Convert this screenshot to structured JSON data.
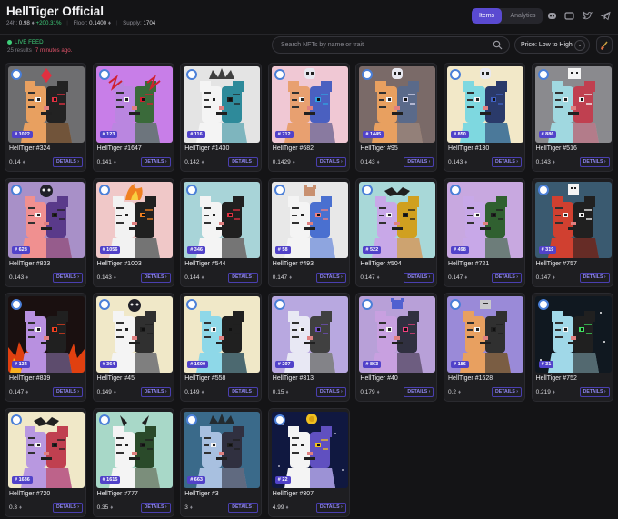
{
  "header": {
    "title": "HellTiger Official",
    "stats": {
      "vol_label": "24h:",
      "vol_value": "0.98",
      "vol_change": "+200.31%",
      "floor_label": "Floor:",
      "floor_value": "0.1400",
      "supply_label": "Supply:",
      "supply_value": "1704"
    },
    "tabs": [
      {
        "label": "Items",
        "active": true
      },
      {
        "label": "Analytics",
        "active": false
      }
    ],
    "icons": [
      "discord-icon",
      "website-icon",
      "twitter-icon",
      "telegram-icon"
    ]
  },
  "toolbar": {
    "live_label": "LIVE FEED",
    "results_text": "25 results",
    "updated_text": "7 minutes ago.",
    "search_placeholder": "Search NFTs by name or trait",
    "sort_label": "Price: Low to High"
  },
  "colors": {
    "accent": "#5a4ad1",
    "positive": "#3fcf7a",
    "negative": "#e2536a"
  },
  "items": [
    {
      "name": "HellTiger #324",
      "id": "# 1022",
      "price": "0.14",
      "details": "DETAILS ›",
      "bg": "#6e6e70",
      "fur": "#e8a060",
      "face": "#222222",
      "accent": "#e03040",
      "ornament": "diamond"
    },
    {
      "name": "HellTiger #1647",
      "id": "# 123",
      "price": "0.141",
      "details": "DETAILS ›",
      "bg": "#c87ee8",
      "fur": "#ba86e0",
      "face": "#3a6a3a",
      "accent": "#d02030",
      "ornament": "bolts"
    },
    {
      "name": "HellTiger #1430",
      "id": "# 116",
      "price": "0.142",
      "details": "DETAILS ›",
      "bg": "#e4e4e4",
      "fur": "#f4f4f4",
      "face": "#2e8a9a",
      "accent": "#222222",
      "ornament": "crown"
    },
    {
      "name": "HellTiger #682",
      "id": "# 712",
      "price": "0.1429",
      "details": "DETAILS ›",
      "bg": "#f0c8d4",
      "fur": "#e8a070",
      "face": "#4a60c0",
      "accent": "#30a0e0",
      "ornament": "skull"
    },
    {
      "name": "HellTiger #95",
      "id": "# 1445",
      "price": "0.143",
      "details": "DETAILS ›",
      "bg": "#7a6a68",
      "fur": "#e8a060",
      "face": "#5a6a8a",
      "accent": "#d8d8f0",
      "ornament": "skull"
    },
    {
      "name": "HellTiger #130",
      "id": "# 850",
      "price": "0.143",
      "details": "DETAILS ›",
      "bg": "#f2e8c8",
      "fur": "#7ed8e0",
      "face": "#2a3a6a",
      "accent": "#4060c0",
      "ornament": "skull"
    },
    {
      "name": "HellTiger #516",
      "id": "# 886",
      "price": "0.143",
      "details": "DETAILS ›",
      "bg": "#8a8a8e",
      "fur": "#a0d8e0",
      "face": "#c04050",
      "accent": "#f0f0f0",
      "ornament": "cat"
    },
    {
      "name": "HellTiger #833",
      "id": "# 628",
      "price": "0.143",
      "details": "DETAILS ›",
      "bg": "#a890c8",
      "fur": "#f09090",
      "face": "#5a3a8a",
      "accent": "#202020",
      "ornament": "blob"
    },
    {
      "name": "HellTiger #1003",
      "id": "# 1056",
      "price": "0.143",
      "details": "DETAILS ›",
      "bg": "#f0c8c8",
      "fur": "#f2f2f2",
      "face": "#202020",
      "accent": "#f08020",
      "ornament": "flame"
    },
    {
      "name": "HellTiger #544",
      "id": "# 346",
      "price": "0.144",
      "details": "DETAILS ›",
      "bg": "#a8d4d8",
      "fur": "#f4f4f4",
      "face": "#202020",
      "accent": "#e03040",
      "ornament": "none"
    },
    {
      "name": "HellTiger #493",
      "id": "# 58",
      "price": "0.147",
      "details": "DETAILS ›",
      "bg": "#e8e8e8",
      "fur": "#f4f4f4",
      "face": "#4a70d0",
      "accent": "#f08080",
      "ornament": "bear"
    },
    {
      "name": "HellTiger #504",
      "id": "# 522",
      "price": "0.147",
      "details": "DETAILS ›",
      "bg": "#a8d8d8",
      "fur": "#c8a8e8",
      "face": "#d0a020",
      "accent": "#202020",
      "ornament": "bat"
    },
    {
      "name": "HellTiger #721",
      "id": "# 498",
      "price": "0.147",
      "details": "DETAILS ›",
      "bg": "#c8a8e0",
      "fur": "#c8a8e8",
      "face": "#306030",
      "accent": "#202020",
      "ornament": "none"
    },
    {
      "name": "HellTiger #757",
      "id": "# 319",
      "price": "0.147",
      "details": "DETAILS ›",
      "bg": "#3a5a70",
      "fur": "#d04030",
      "face": "#202020",
      "accent": "#f0f0f0",
      "ornament": "ghost"
    },
    {
      "name": "HellTiger #839",
      "id": "# 134",
      "price": "0.147",
      "details": "DETAILS ›",
      "bg": "#1a1010",
      "fur": "#b890e0",
      "face": "#202020",
      "accent": "#f04020",
      "ornament": "fire"
    },
    {
      "name": "HellTiger #45",
      "id": "# 364",
      "price": "0.149",
      "details": "DETAILS ›",
      "bg": "#f0e8c8",
      "fur": "#f4f4f4",
      "face": "#303030",
      "accent": "#202020",
      "ornament": "blob"
    },
    {
      "name": "HellTiger #558",
      "id": "# 1600",
      "price": "0.149",
      "details": "DETAILS ›",
      "bg": "#f0e8c8",
      "fur": "#8ed8e8",
      "face": "#202020",
      "accent": "#202020",
      "ornament": "none"
    },
    {
      "name": "HellTiger #313",
      "id": "# 297",
      "price": "0.15",
      "details": "DETAILS ›",
      "bg": "#b8a8e0",
      "fur": "#e8e8f4",
      "face": "#404040",
      "accent": "#7050c0",
      "ornament": "none"
    },
    {
      "name": "HellTiger #40",
      "id": "# 863",
      "price": "0.179",
      "details": "DETAILS ›",
      "bg": "#b8a0d8",
      "fur": "#c8a0e0",
      "face": "#303040",
      "accent": "#f04080",
      "ornament": "devil"
    },
    {
      "name": "HellTiger #1628",
      "id": "# 186",
      "price": "0.2",
      "details": "DETAILS ›",
      "bg": "#9a8ad8",
      "fur": "#e8a060",
      "face": "#303030",
      "accent": "#202020",
      "ornament": "robot"
    },
    {
      "name": "HellTiger #752",
      "id": "# 31",
      "price": "0.219",
      "details": "DETAILS ›",
      "bg": "#101820",
      "fur": "#a0d8e8",
      "face": "#202020",
      "accent": "#40e060",
      "ornament": "stars"
    },
    {
      "name": "HellTiger #720",
      "id": "# 1636",
      "price": "0.3",
      "details": "DETAILS ›",
      "bg": "#f0e8c8",
      "fur": "#b898e0",
      "face": "#c04050",
      "accent": "#202020",
      "ornament": "bat"
    },
    {
      "name": "HellTiger #777",
      "id": "# 1615",
      "price": "0.35",
      "details": "DETAILS ›",
      "bg": "#a8d8c8",
      "fur": "#f4f4f4",
      "face": "#2a4a2a",
      "accent": "#202020",
      "ornament": "horns"
    },
    {
      "name": "HellTiger #3",
      "id": "# 663",
      "price": "3",
      "details": "DETAILS ›",
      "bg": "#3a6a8a",
      "fur": "#a8c0e0",
      "face": "#303040",
      "accent": "#202020",
      "ornament": "crown"
    },
    {
      "name": "HellTiger #307",
      "id": "# 22",
      "price": "4.99",
      "details": "DETAILS ›",
      "bg": "#101840",
      "fur": "#f4f4f4",
      "face": "#6050c0",
      "accent": "#f0c020",
      "ornament": "coin"
    }
  ]
}
